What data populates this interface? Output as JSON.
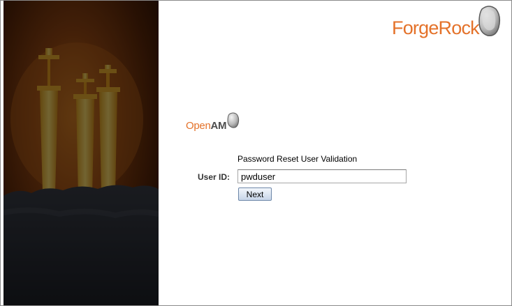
{
  "branding": {
    "company_name": "ForgeRock",
    "product_name_open": "Open",
    "product_name_am": "AM"
  },
  "form": {
    "title": "Password Reset User Validation",
    "user_id_label": "User ID:",
    "user_id_value": "pwduser",
    "next_label": "Next"
  },
  "colors": {
    "brand_orange": "#e4722a",
    "logo_gray": "#4d4d4d",
    "button_border": "#6c86a8"
  },
  "icons": [
    "forgerock-rock-icon",
    "openam-rock-icon"
  ]
}
